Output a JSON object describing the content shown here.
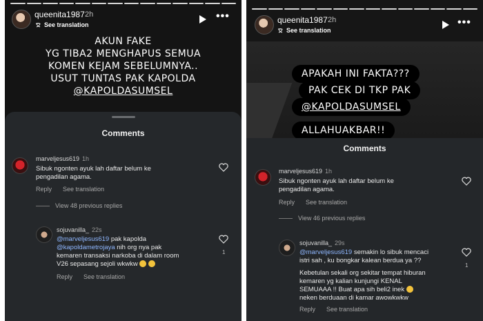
{
  "stories": [
    {
      "username": "queenita1987",
      "time": "2h",
      "see_translation": "See translation",
      "caption": [
        "AKUN FAKE",
        "YG TIBA2 MENGHAPUS SEMUA",
        "KOMEN KEJAM SEBELUMNYA..",
        "USUT TUNTAS PAK KAPOLDA"
      ],
      "caption_link": "@KAPOLDASUMSEL",
      "comments_title": "Comments",
      "comment": {
        "user": "marveljesus619",
        "time": "1h",
        "text": [
          "Sibuk ngonten ayuk lah daftar belum ke",
          "pengadilan agama."
        ],
        "reply": "Reply",
        "see_translation": "See translation"
      },
      "view_replies": "View 48 previous replies",
      "reply_comment": {
        "user": "sojuvanilla_",
        "time": "22s",
        "mention1": "@marveljesus619",
        "line1_rest": " pak kapolda",
        "mention2": "@kapoldametrojaya",
        "line2_rest": " nih org nya pak",
        "lines": [
          "kemaren transaksi narkoba di dalam room",
          "V26 sepasang sejoli wkwkw"
        ],
        "like_count": "1",
        "reply": "Reply",
        "see_translation": "See translation"
      }
    },
    {
      "username": "queenita1987",
      "time": "2h",
      "see_translation": "See translation",
      "pills": [
        "APAKAH INI FAKTA???",
        "PAK CEK DI TKP PAK",
        "@KAPOLDASUMSEL",
        "ALLAHUAKBAR!!"
      ],
      "comments_title": "Comments",
      "comment": {
        "user": "marveljesus619",
        "time": "1h",
        "text": [
          "Sibuk ngonten ayuk lah daftar belum ke",
          "pengadilan agama."
        ],
        "reply": "Reply",
        "see_translation": "See translation"
      },
      "view_replies": "View 46 previous replies",
      "reply_comment": {
        "user": "sojuvanilla_",
        "time": "29s",
        "mention1": "@marveljesus619",
        "line1_rest": " semakin lo sibuk mencaci",
        "lines": [
          "istri sah , ku bongkar kalean berdua ya ??",
          "",
          "Kebetulan sekali org sekitar tempat hiburan",
          "kemaren yg kalian kunjungi KENAL",
          "SEMUAAA !! Buat apa sih beli2 inek",
          "neken berduaan di kamar awowkwkw"
        ],
        "like_count": "1",
        "reply": "Reply",
        "see_translation": "See translation"
      }
    }
  ],
  "colors": {
    "mention": "#8fb7ff",
    "panel": "#25282b",
    "story_bg": "#141414"
  },
  "icons": [
    "play-icon",
    "more-icon",
    "translate-icon",
    "heart-icon",
    "emoji-icon"
  ]
}
